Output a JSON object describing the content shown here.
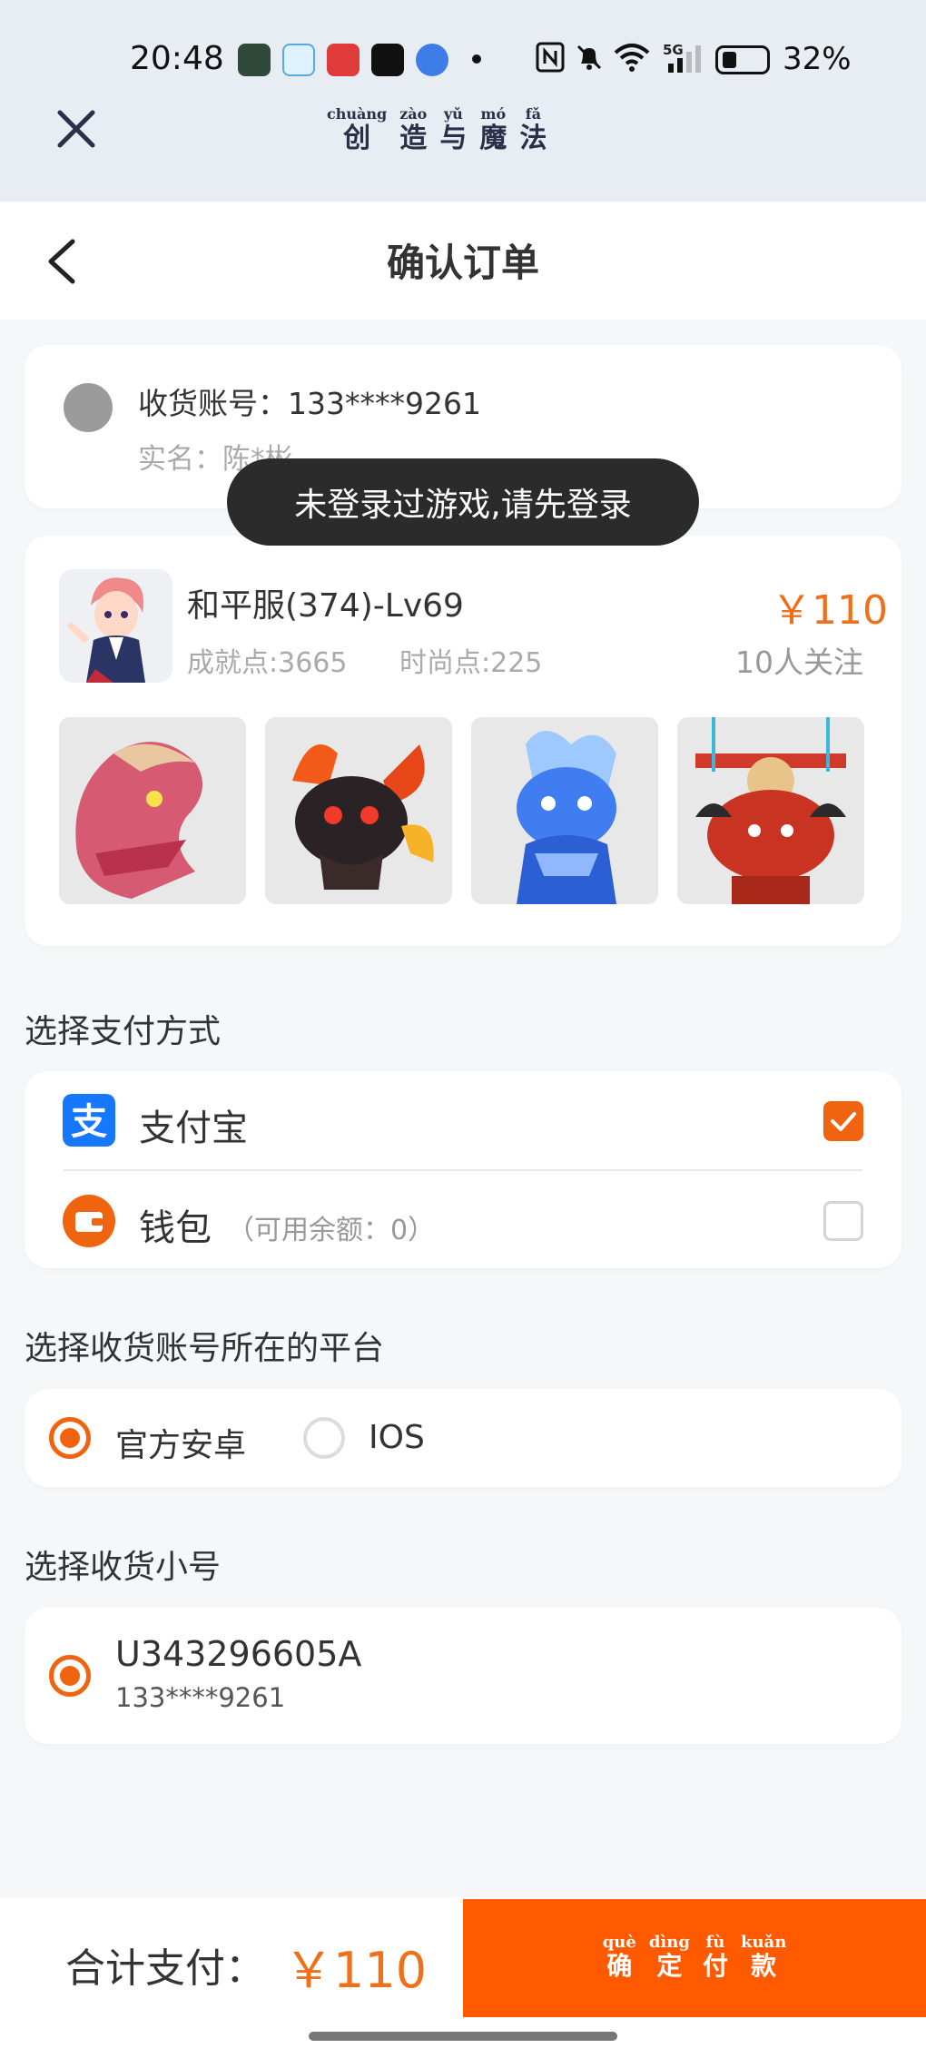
{
  "status": {
    "time": "20:48",
    "network": "5G",
    "battery": "32%",
    "battery_level": 0.32
  },
  "topbar": {
    "close_icon": "close-icon",
    "title_chars": [
      {
        "han": "创",
        "pinyin": "chuàng"
      },
      {
        "han": "造",
        "pinyin": "zào"
      },
      {
        "han": "与",
        "pinyin": "yǔ"
      },
      {
        "han": "魔",
        "pinyin": "mó"
      },
      {
        "han": "法",
        "pinyin": "fǎ"
      }
    ]
  },
  "header": {
    "back_icon": "chevron-left-icon",
    "title": "确认订单"
  },
  "account": {
    "label": "收货账号：133****9261",
    "real_name": "实名：陈*彬"
  },
  "toast": "未登录过游戏,请先登录",
  "item": {
    "title": "和平服(374)-Lv69",
    "price": "￥110",
    "achievement": "成就点:3665",
    "fashion": "时尚点:225",
    "followers": "10人关注"
  },
  "payment": {
    "section_title": "选择支付方式",
    "options": [
      {
        "label": "支付宝",
        "sub": "",
        "icon": "alipay-icon",
        "selected": true
      },
      {
        "label": "钱包",
        "sub": "（可用余额：0）",
        "icon": "wallet-icon",
        "selected": false
      }
    ]
  },
  "platform": {
    "section_title": "选择收货账号所在的平台",
    "options": [
      {
        "label": "官方安卓",
        "selected": true
      },
      {
        "label": "IOS",
        "selected": false
      }
    ]
  },
  "sub_account": {
    "section_title": "选择收货小号",
    "name": "U343296605A",
    "phone": "133****9261",
    "selected": true
  },
  "footer": {
    "total_label": "合计支付：",
    "total_price": "￥110",
    "pay_chars": [
      {
        "han": "确",
        "pinyin": "què"
      },
      {
        "han": "定",
        "pinyin": "dìng"
      },
      {
        "han": "付",
        "pinyin": "fù"
      },
      {
        "han": "款",
        "pinyin": "kuǎn"
      }
    ]
  },
  "colors": {
    "accent": "#f06410",
    "button": "#ff5a00",
    "price": "#f0701a",
    "alipay": "#1677ff"
  }
}
